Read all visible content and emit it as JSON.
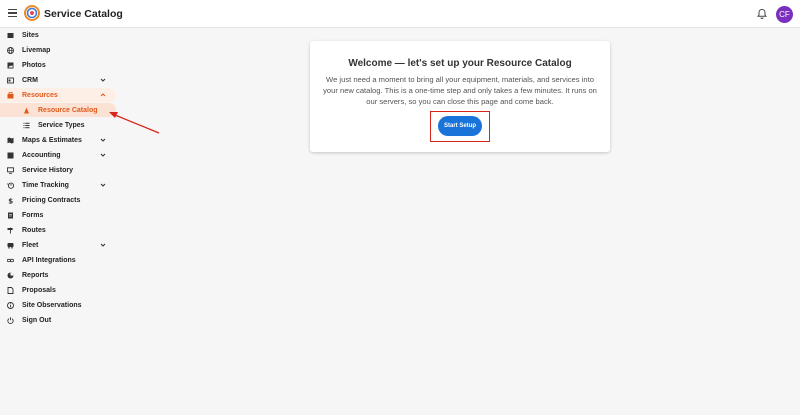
{
  "header": {
    "title": "Service Catalog",
    "avatar_initials": "CF"
  },
  "sidebar": {
    "items": [
      {
        "label": "Sites",
        "icon": "sites-icon"
      },
      {
        "label": "Livemap",
        "icon": "globe-icon"
      },
      {
        "label": "Photos",
        "icon": "photo-icon"
      },
      {
        "label": "CRM",
        "icon": "crm-icon",
        "expandable": true
      },
      {
        "label": "Resources",
        "icon": "resources-icon",
        "expandable": true,
        "expanded": true
      },
      {
        "label": "Resource Catalog",
        "icon": "catalog-icon",
        "sub": true,
        "active": true
      },
      {
        "label": "Service Types",
        "icon": "list-icon",
        "sub": true
      },
      {
        "label": "Maps & Estimates",
        "icon": "map-icon",
        "expandable": true
      },
      {
        "label": "Accounting",
        "icon": "accounting-icon",
        "expandable": true
      },
      {
        "label": "Service History",
        "icon": "history-icon"
      },
      {
        "label": "Time Tracking",
        "icon": "clock-icon",
        "expandable": true
      },
      {
        "label": "Pricing Contracts",
        "icon": "dollar-icon"
      },
      {
        "label": "Forms",
        "icon": "forms-icon"
      },
      {
        "label": "Routes",
        "icon": "routes-icon"
      },
      {
        "label": "Fleet",
        "icon": "truck-icon",
        "expandable": true
      },
      {
        "label": "API Integrations",
        "icon": "link-icon"
      },
      {
        "label": "Reports",
        "icon": "reports-icon"
      },
      {
        "label": "Proposals",
        "icon": "document-icon"
      },
      {
        "label": "Site Observations",
        "icon": "info-icon"
      },
      {
        "label": "Sign Out",
        "icon": "power-icon"
      }
    ]
  },
  "main": {
    "card_title": "Welcome — let's set up your Resource Catalog",
    "card_body": "We just need a moment to bring all your equipment, materials, and services into your new catalog. This is a one-time step and only takes a few minutes. It runs on our servers, so you can close this page and come back.",
    "start_button": "Start Setup"
  },
  "colors": {
    "accent": "#e05a1c",
    "primary_button": "#1a73d9",
    "highlight": "#d9261c",
    "avatar": "#7b2fbe"
  }
}
